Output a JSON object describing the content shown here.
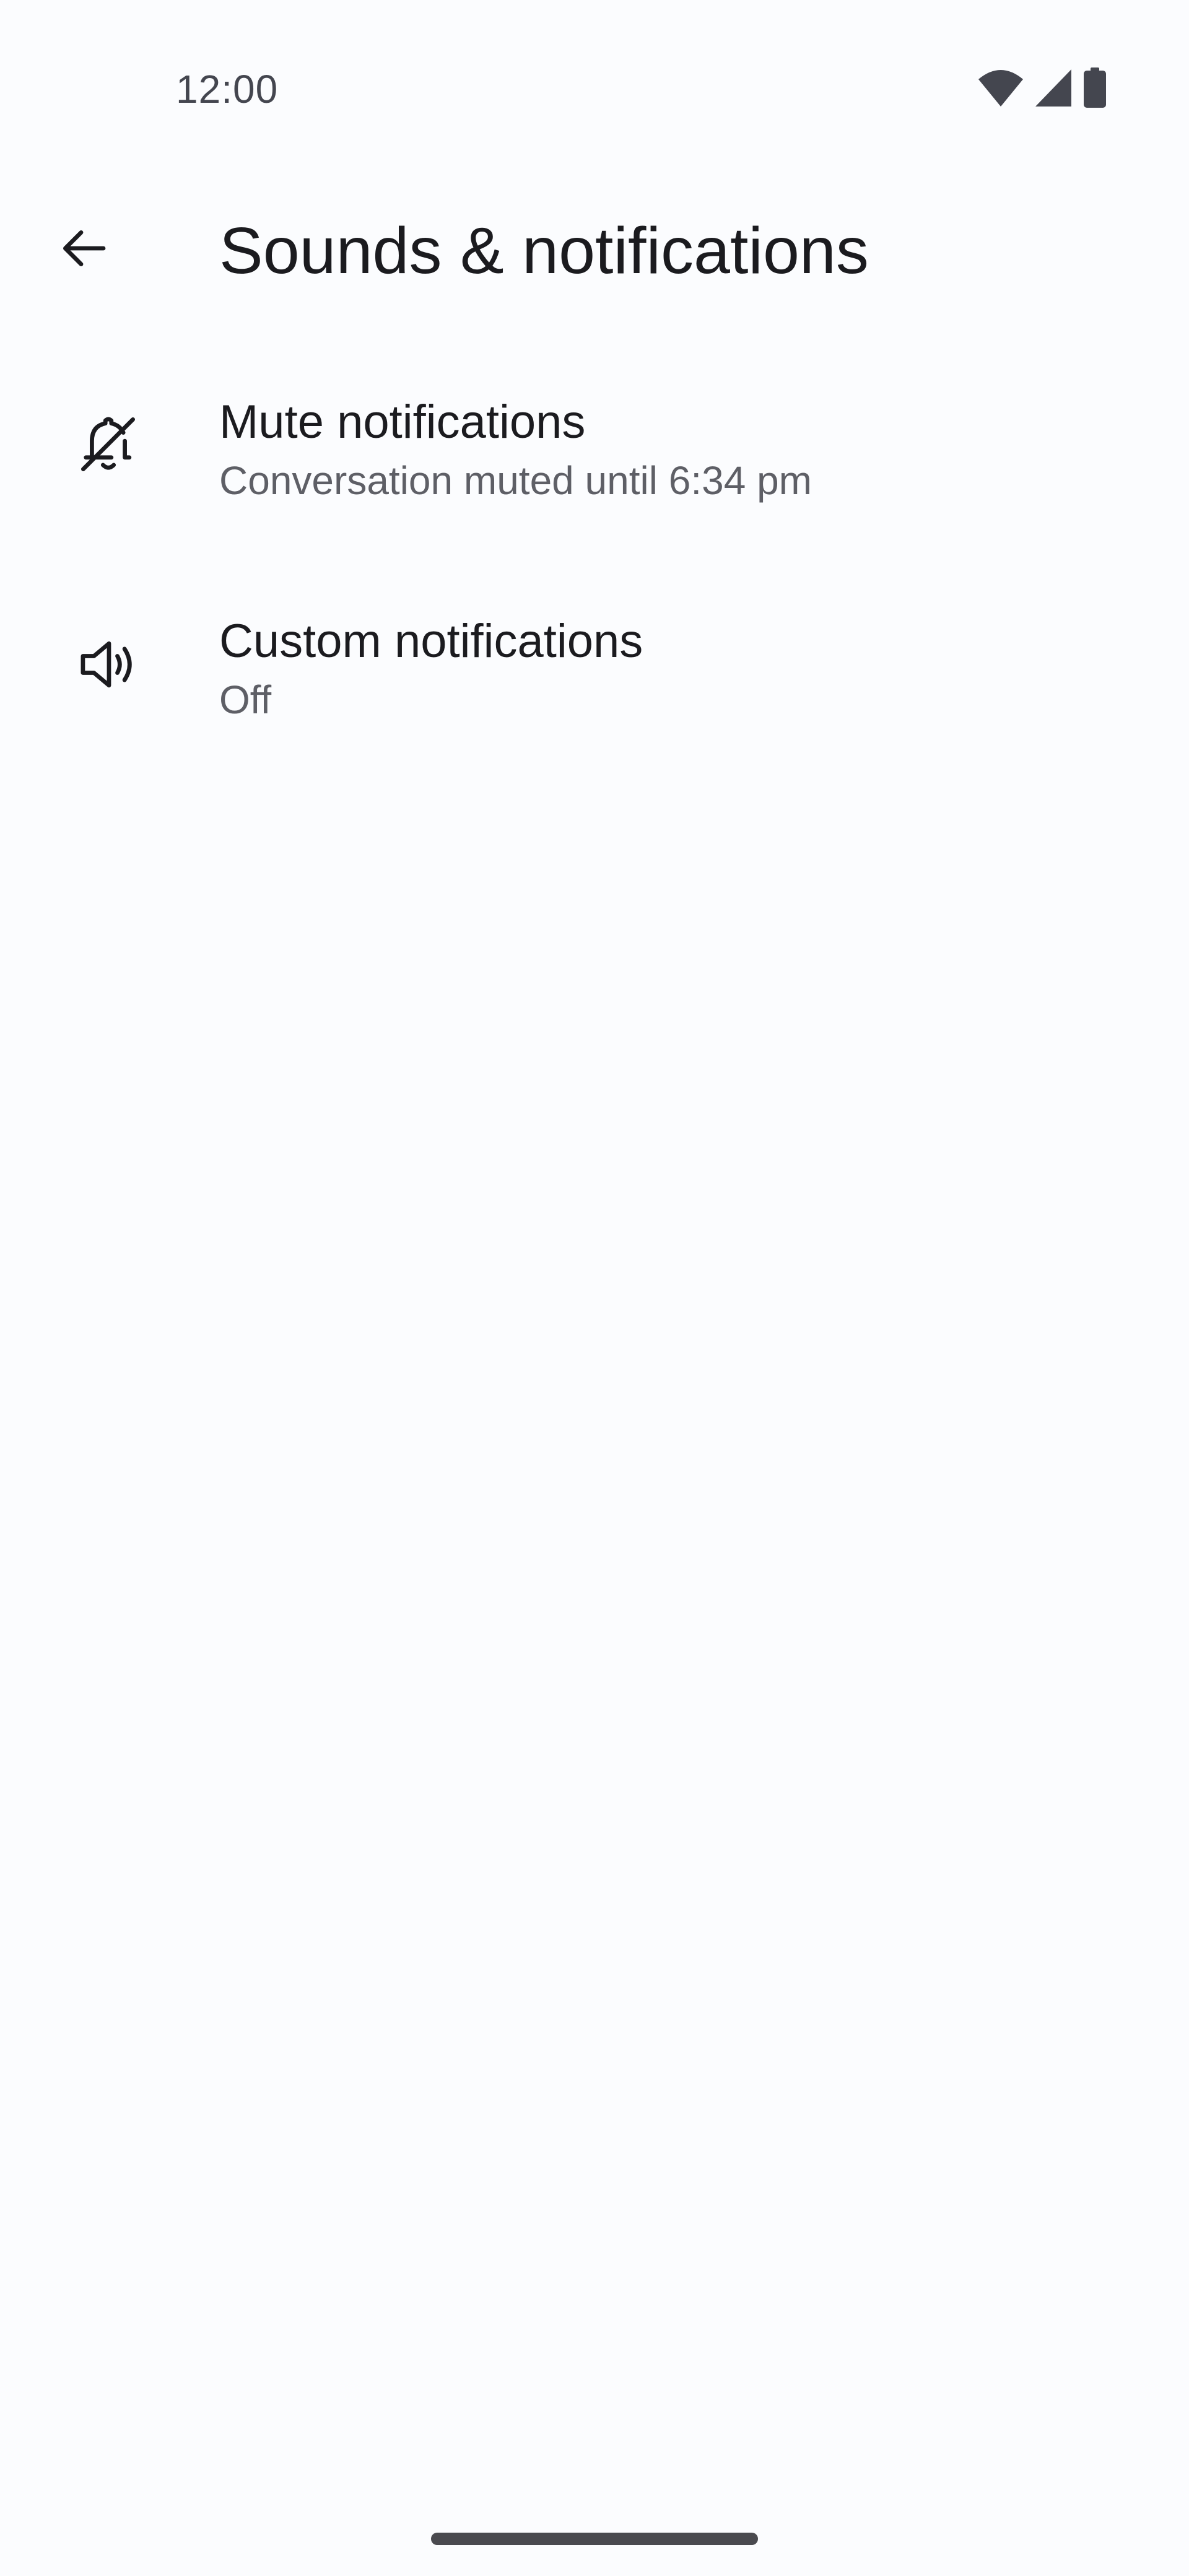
{
  "status_bar": {
    "time": "12:00",
    "icons": [
      "wifi-icon",
      "cellular-signal-icon",
      "battery-icon"
    ]
  },
  "app_bar": {
    "back_icon": "arrow-back-icon",
    "title": "Sounds & notifications"
  },
  "settings": [
    {
      "icon": "bell-off-icon",
      "title": "Mute notifications",
      "summary": "Conversation muted until 6:34 pm"
    },
    {
      "icon": "speaker-volume-icon",
      "title": "Custom notifications",
      "summary": "Off"
    }
  ],
  "colors": {
    "background": "#fbfcfe",
    "primary_text": "#1b1b1f",
    "secondary_text": "#5e5f66",
    "status_text": "#44464f"
  }
}
